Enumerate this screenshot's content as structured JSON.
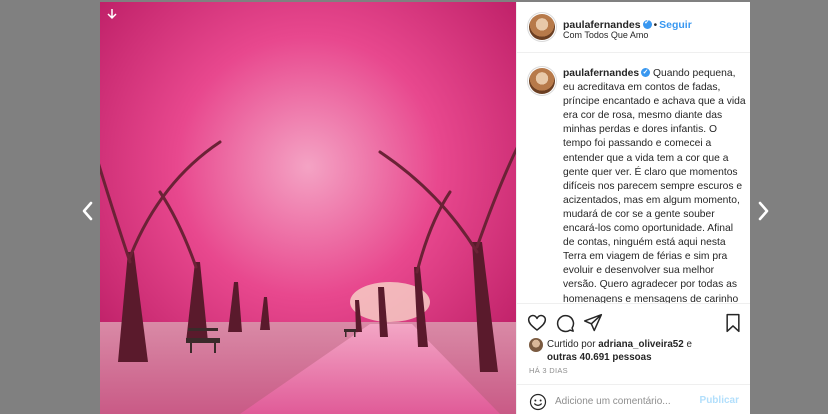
{
  "post": {
    "username": "paulafernandes",
    "follow_label": "Seguir",
    "separator": "•",
    "location": "Com Todos Que Amo",
    "caption": "Quando pequena, eu acreditava em contos de fadas, príncipe encantado e achava que a vida era cor de rosa, mesmo diante das minhas perdas e dores infantis. O tempo foi passando e comecei a entender que a vida tem a cor que a gente quer ver. É claro que momentos difíceis nos parecem sempre escuros e acizentados, mas em algum momento, mudará de cor se a gente souber encará-los como oportunidade. Afinal de contas, ninguém está aqui nesta Terra em viagem de férias e sim pra evoluir e desenvolver sua melhor versão. Quero agradecer por todas as homenagens e mensagens de carinho de amigos, familiares",
    "liked_prefix": "Curtido por",
    "liked_user": "adriana_oliveira52",
    "liked_and": "e",
    "liked_others": "outras 40.691 pessoas",
    "time_ago": "HÁ 3 DIAS"
  },
  "comment": {
    "placeholder": "Adicione um comentário...",
    "publish_label": "Publicar"
  },
  "icons": {
    "prev": "chevron-left-icon",
    "next": "chevron-right-icon",
    "like": "heart-icon",
    "comment": "comment-icon",
    "share": "share-icon",
    "save": "bookmark-icon",
    "emoji": "smiley-icon",
    "verified": "verified-badge-icon"
  },
  "colors": {
    "backdrop": "#808080",
    "link_blue": "#3897f0",
    "publish_disabled": "#b2dffc",
    "blossom_pink": "#e8488e"
  }
}
